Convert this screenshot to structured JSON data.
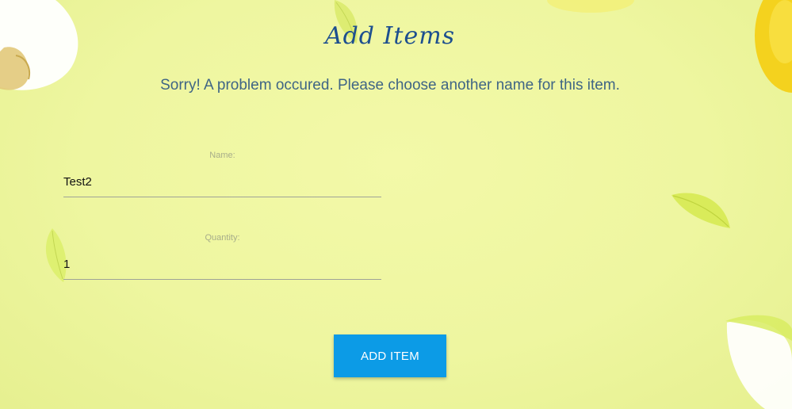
{
  "page": {
    "title": "Add Items",
    "error_message": "Sorry! A problem occured. Please choose another name for this item."
  },
  "form": {
    "name": {
      "label": "Name:",
      "value": "Test2"
    },
    "quantity": {
      "label": "Quantity:",
      "value": "1"
    },
    "submit_label": "ADD ITEM"
  },
  "colors": {
    "background": "#eef6a0",
    "title": "#1d4f8f",
    "message": "#3f6585",
    "button": "#0c9be6"
  },
  "icons": [
    "flower-petal-icon",
    "leaf-icon",
    "lemon-icon"
  ]
}
